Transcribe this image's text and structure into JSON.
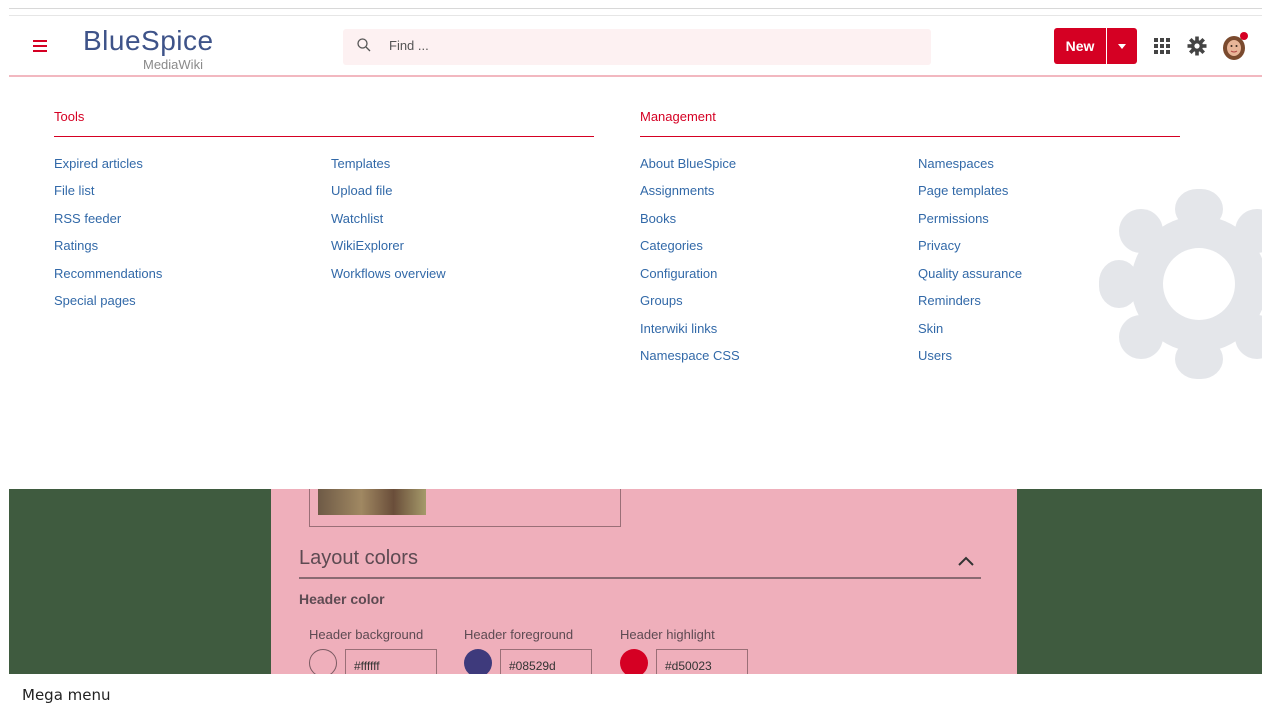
{
  "header": {
    "logo_main": "BlueSpice",
    "logo_sub": "MediaWiki",
    "search_placeholder": "Find ...",
    "new_button": "New",
    "brand_color": "#d50023",
    "logo_color": "#3e5389"
  },
  "mega_menu": {
    "tools": {
      "title": "Tools",
      "col1": [
        "Expired articles",
        "File list",
        "RSS feeder",
        "Ratings",
        "Recommendations",
        "Special pages"
      ],
      "col2": [
        "Templates",
        "Upload file",
        "Watchlist",
        "WikiExplorer",
        "Workflows overview"
      ]
    },
    "management": {
      "title": "Management",
      "col1": [
        "About BlueSpice",
        "Assignments",
        "Books",
        "Categories",
        "Configuration",
        "Groups",
        "Interwiki links",
        "Namespace CSS"
      ],
      "col2": [
        "Namespaces",
        "Page templates",
        "Permissions",
        "Privacy",
        "Quality assurance",
        "Reminders",
        "Skin",
        "Users"
      ]
    }
  },
  "page": {
    "section_title": "Layout colors",
    "subsection_title": "Header color",
    "fields": [
      {
        "label": "Header background",
        "value": "#ffffff",
        "swatch": "#ffffff"
      },
      {
        "label": "Header foreground",
        "value": "#08529d",
        "swatch": "#3e3a7c"
      },
      {
        "label": "Header highlight",
        "value": "#d50023",
        "swatch": "#d50023"
      }
    ]
  },
  "caption": "Mega menu"
}
